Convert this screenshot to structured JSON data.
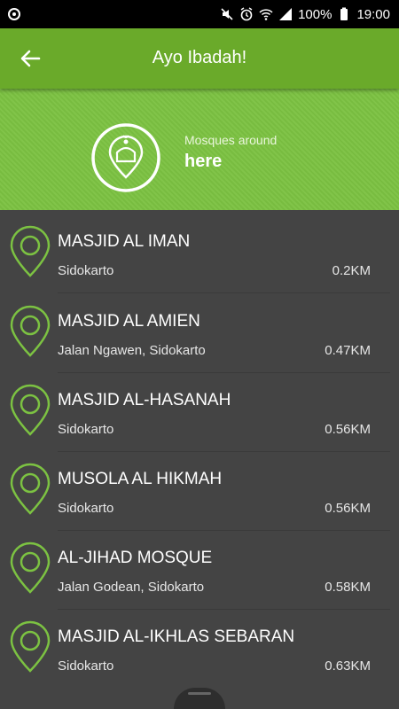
{
  "status_bar": {
    "battery_text": "100%",
    "time": "19:00",
    "icons": [
      "mute-icon",
      "alarm-icon",
      "wifi-icon",
      "signal-icon",
      "battery-icon"
    ]
  },
  "app_bar": {
    "title": "Ayo Ibadah!",
    "back_icon": "arrow-left-icon"
  },
  "hero": {
    "subtitle": "Mosques around",
    "title": "here",
    "icon": "mosque-location-icon"
  },
  "colors": {
    "appbar": "#6aaa2a",
    "hero": "#7cc242",
    "list_bg": "#444444",
    "pin": "#7cc242"
  },
  "mosques": [
    {
      "name": "MASJID AL IMAN",
      "address": "Sidokarto",
      "distance": "0.2KM"
    },
    {
      "name": "MASJID AL AMIEN",
      "address": "Jalan Ngawen, Sidokarto",
      "distance": "0.47KM"
    },
    {
      "name": "MASJID AL-HASANAH",
      "address": "Sidokarto",
      "distance": "0.56KM"
    },
    {
      "name": "MUSOLA AL HIKMAH",
      "address": "Sidokarto",
      "distance": "0.56KM"
    },
    {
      "name": "AL-JIHAD MOSQUE",
      "address": "Jalan Godean, Sidokarto",
      "distance": "0.58KM"
    },
    {
      "name": "MASJID AL-IKHLAS SEBARAN",
      "address": "Sidokarto",
      "distance": "0.63KM"
    }
  ]
}
